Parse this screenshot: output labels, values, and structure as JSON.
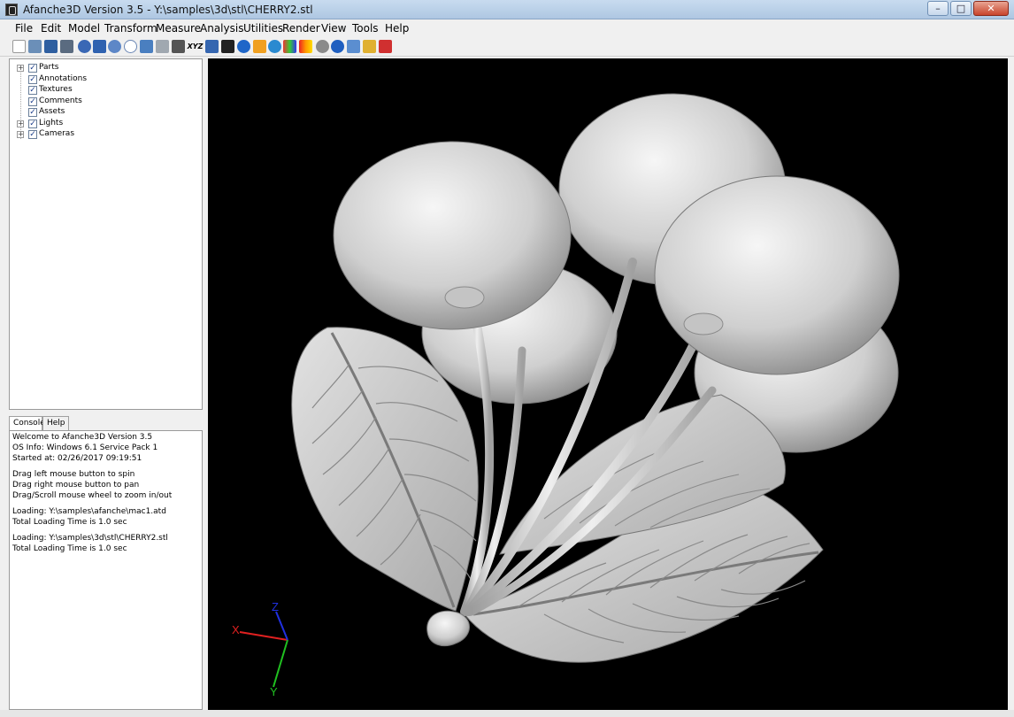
{
  "window": {
    "title": "Afanche3D Version 3.5 - Y:\\samples\\3d\\stl\\CHERRY2.stl",
    "minimize": "–",
    "maximize": "□",
    "close": "✕"
  },
  "menu": [
    "File",
    "Edit",
    "Model",
    "Transform",
    "Measure",
    "Analysis",
    "Utilities",
    "Render",
    "View",
    "Tools",
    "Help"
  ],
  "toolbar": {
    "buttons": [
      "new-icon",
      "open-icon",
      "save-icon",
      "print-icon",
      "undo-icon",
      "redo-icon",
      "link-icon",
      "comment-icon",
      "layers-icon",
      "printer-icon",
      "camera-icon",
      "xyz-icon",
      "measure-icon",
      "film-icon",
      "info-icon",
      "snapshot-icon",
      "refresh-icon",
      "palette-icon",
      "color-bar-icon",
      "gear-icon",
      "help-icon",
      "mail-icon",
      "pen-icon",
      "export-icon"
    ],
    "xyz_label": "XYZ"
  },
  "tree": {
    "items": [
      {
        "label": "Parts",
        "expandable": true,
        "checked": true
      },
      {
        "label": "Annotations",
        "expandable": false,
        "checked": true
      },
      {
        "label": "Textures",
        "expandable": false,
        "checked": true
      },
      {
        "label": "Comments",
        "expandable": false,
        "checked": true
      },
      {
        "label": "Assets",
        "expandable": false,
        "checked": true
      },
      {
        "label": "Lights",
        "expandable": true,
        "checked": true
      },
      {
        "label": "Cameras",
        "expandable": true,
        "checked": true
      }
    ]
  },
  "tabs": {
    "console": "Console",
    "help": "Help"
  },
  "console": {
    "lines": [
      "Welcome to Afanche3D Version 3.5",
      "OS Info: Windows 6.1 Service Pack 1",
      "Started at: 02/26/2017 09:19:51",
      "",
      "Drag left mouse button to spin",
      "Drag right mouse button to pan",
      "Drag/Scroll mouse wheel to zoom in/out",
      "",
      "Loading: Y:\\samples\\afanche\\mac1.atd",
      "Total Loading Time is 1.0 sec",
      "",
      "Loading: Y:\\samples\\3d\\stl\\CHERRY2.stl",
      "Total Loading Time is 1.0 sec"
    ]
  },
  "axes": {
    "x": "X",
    "y": "Y",
    "z": "Z",
    "x_color": "#e02020",
    "y_color": "#20c020",
    "z_color": "#2030e0"
  }
}
